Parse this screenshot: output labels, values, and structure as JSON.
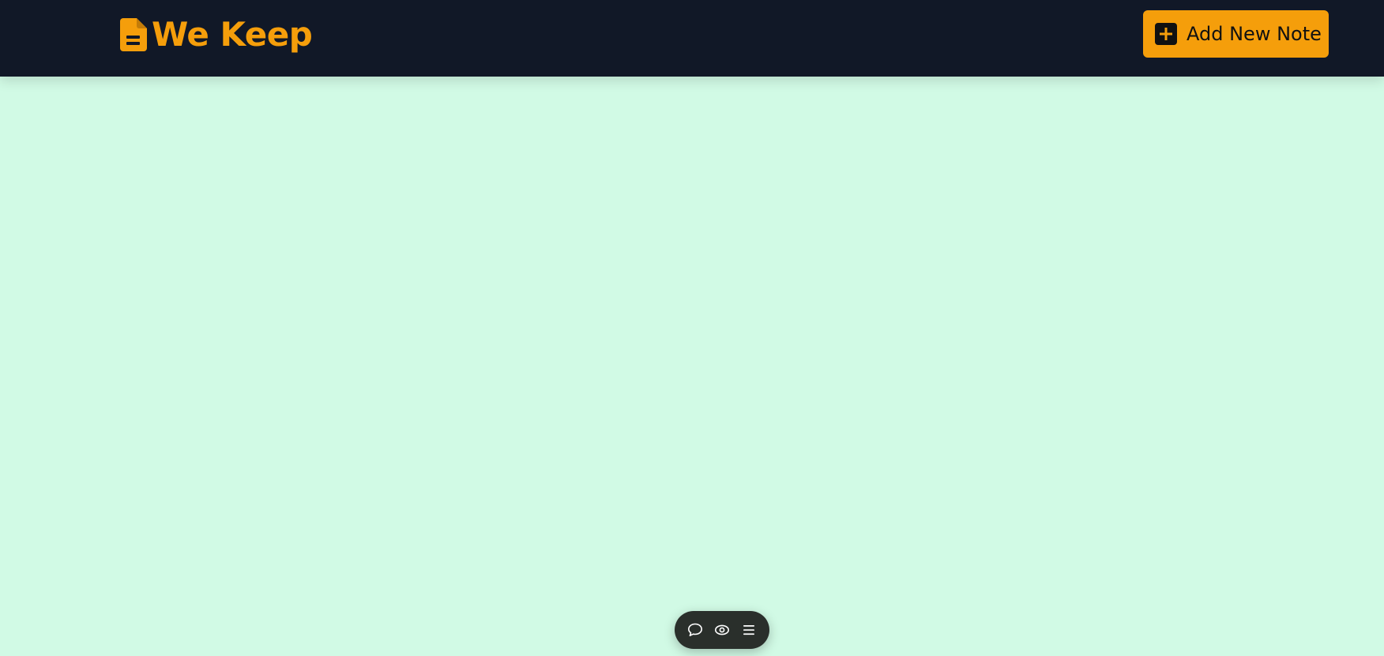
{
  "header": {
    "brand_name": "We Keep",
    "brand_icon": "file-lines-icon",
    "add_note_label": "Add New Note",
    "add_note_icon": "square-plus-icon"
  },
  "toolbar": {
    "items": [
      {
        "icon": "comment-icon"
      },
      {
        "icon": "eye-icon"
      },
      {
        "icon": "menu-icon"
      }
    ]
  },
  "colors": {
    "header_bg": "#111827",
    "accent": "#f59e0b",
    "page_bg": "#d1fae5",
    "toolbar_bg": "#2a2f2b"
  }
}
